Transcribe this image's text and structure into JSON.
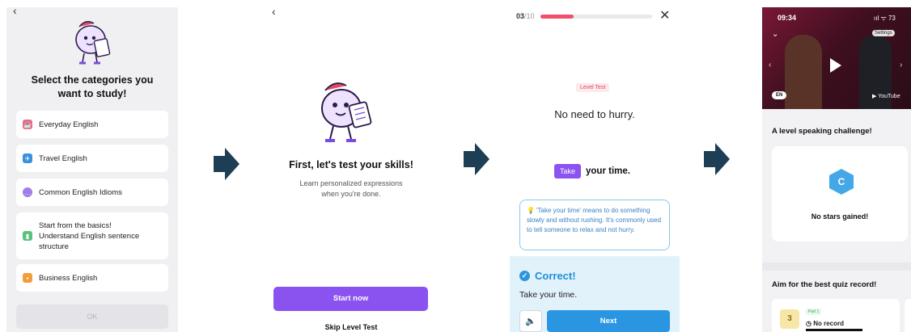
{
  "screen1": {
    "back_icon": "chevron-left-icon",
    "title": "Select the categories you\nwant to study!",
    "categories": [
      {
        "label": "Everyday English",
        "icon": "coffee-cup-icon",
        "color": "#e86a8a"
      },
      {
        "label": "Travel English",
        "icon": "airplane-icon",
        "color": "#3b8fe0"
      },
      {
        "label": "Common English Idioms",
        "icon": "chat-bubble-icon",
        "color": "#a07ee8"
      },
      {
        "label": "Start from the basics!\nUnderstand English sentence\nstructure",
        "icon": "bar-chart-icon",
        "color": "#5cc27a"
      },
      {
        "label": "Business English",
        "icon": "briefcase-icon",
        "color": "#f39c3a"
      }
    ],
    "ok_label": "OK"
  },
  "screen2": {
    "back_icon": "chevron-left-icon",
    "title": "First, let's test your skills!",
    "subtitle": "Learn personalized expressions\nwhen you're done.",
    "start_label": "Start now",
    "skip_label": "Skip Level Test"
  },
  "screen3": {
    "counter_current": "03",
    "counter_total": "/10",
    "progress": 0.3,
    "badge": "Level Test",
    "prompt": "No need to hurry.",
    "answer_chip": "Take",
    "answer_rest": "your time.",
    "hint": "'Take your time' means to do something slowly and without rushing. It's commonly used to tell someone to relax and not hurry.",
    "result_title": "Correct!",
    "result_answer": "Take your time.",
    "next_label": "Next"
  },
  "screen4": {
    "time": "09:34",
    "status_icons": "ııl ᯤ 73",
    "settings_label": "Settings",
    "language_badge": "EN",
    "youtube_label": "▶ YouTube",
    "headline": "A level speaking challenge!",
    "level_letter": "C",
    "no_stars": "No stars gained!",
    "aim_title": "Aim for the best quiz record!",
    "record_star": "3",
    "record_part": "Part 1",
    "record_text": "◷ No record"
  },
  "colors": {
    "accent_purple": "#8a53f0",
    "progress_red": "#f0506b",
    "correct_blue": "#2a96e1",
    "arrow": "#1d3e55"
  }
}
